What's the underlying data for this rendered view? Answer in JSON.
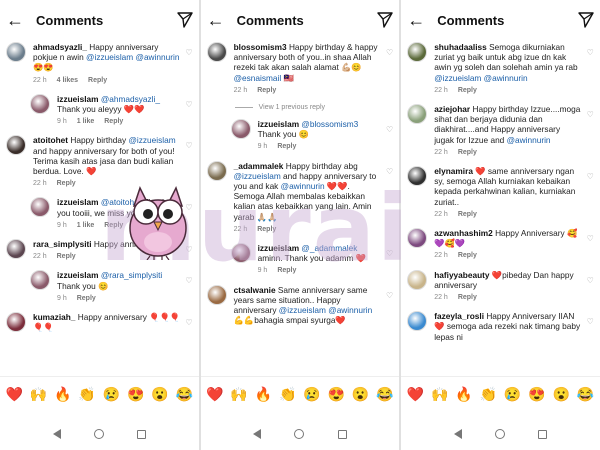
{
  "header": {
    "title": "Comments"
  },
  "emoji_bar": [
    "❤️",
    "🙌",
    "🔥",
    "👏",
    "😢",
    "😍",
    "😮",
    "😂"
  ],
  "watermark": "murai",
  "screens": [
    {
      "items": [
        {
          "kind": "comment",
          "user": "ahmadsyazli_",
          "parts": [
            {
              "t": "Happy anniversary pokjue n awin "
            },
            {
              "m": "@izzueislam"
            },
            {
              "t": " "
            },
            {
              "m": "@awinnurin"
            },
            {
              "t": " 😍😍"
            }
          ],
          "time": "22 h",
          "likes": "4 likes",
          "reply": "Reply",
          "avatar": "#6b7d8c"
        },
        {
          "kind": "reply",
          "user": "izzueislam",
          "parts": [
            {
              "m": "@ahmadsyazli_"
            },
            {
              "t": " Thank you aleyyy ❤️❤️"
            }
          ],
          "time": "9 h",
          "likes": "1 like",
          "reply": "Reply",
          "avatar": "#8a5a6a"
        },
        {
          "kind": "comment",
          "user": "atoitohet",
          "parts": [
            {
              "t": "Happy birthday "
            },
            {
              "m": "@izzueislam"
            },
            {
              "t": " and happy anniversary for both of you! Terima kasih atas jasa dan budi kalian berdua. Love. ❤️"
            }
          ],
          "time": "22 h",
          "likes": "",
          "reply": "Reply",
          "avatar": "#3a2e2a"
        },
        {
          "kind": "reply",
          "user": "izzueislam",
          "parts": [
            {
              "m": "@atoitohet"
            },
            {
              "t": " Thank you tooiii, we miss youu ❤️"
            }
          ],
          "time": "9 h",
          "likes": "1 like",
          "reply": "Reply",
          "avatar": "#8a5a6a"
        },
        {
          "kind": "comment",
          "user": "rara_simplysiti",
          "parts": [
            {
              "t": "Happy anniversary❤️"
            }
          ],
          "time": "22 h",
          "likes": "",
          "reply": "Reply",
          "avatar": "#5c4650"
        },
        {
          "kind": "reply",
          "user": "izzueislam",
          "parts": [
            {
              "m": "@rara_simplysiti"
            },
            {
              "t": " Thank you 😊"
            }
          ],
          "time": "9 h",
          "likes": "",
          "reply": "Reply",
          "avatar": "#8a5a6a"
        },
        {
          "kind": "comment",
          "user": "kumaziah_",
          "parts": [
            {
              "t": "Happy anniversary 🎈🎈🎈🎈🎈"
            }
          ],
          "time": "",
          "likes": "",
          "reply": "",
          "avatar": "#7b2d3b"
        }
      ]
    },
    {
      "items": [
        {
          "kind": "comment",
          "user": "blossomism3",
          "parts": [
            {
              "t": "Happy birthday & happy anniversary both of you..in shaa Allah rezeki tak akan salah alamat 💪🏼😊 "
            },
            {
              "m": "@esnaismail"
            },
            {
              "t": " 🇲🇾"
            }
          ],
          "time": "22 h",
          "likes": "",
          "reply": "Reply",
          "avatar": "#4a4a4a"
        },
        {
          "kind": "view",
          "label": "View 1 previous reply"
        },
        {
          "kind": "reply",
          "user": "izzueislam",
          "parts": [
            {
              "m": "@blossomism3"
            },
            {
              "t": " Thank you 😊"
            }
          ],
          "time": "9 h",
          "likes": "",
          "reply": "Reply",
          "avatar": "#8a5a6a"
        },
        {
          "kind": "comment",
          "user": "_adammalek",
          "parts": [
            {
              "t": "Happy birthday abg "
            },
            {
              "m": "@izzueislam"
            },
            {
              "t": " and happy anniversary to you and kak "
            },
            {
              "m": "@awinnurin"
            },
            {
              "t": " ❤️❤️. Semoga Allah membalas kebaikkan kalian atas kebaikkan yang lain. Amin yarab 🙏🏼🙏🏼"
            }
          ],
          "time": "22 h",
          "likes": "",
          "reply": "Reply",
          "avatar": "#7a6b4e"
        },
        {
          "kind": "reply",
          "user": "izzueislam",
          "parts": [
            {
              "m": "@_adammalek"
            },
            {
              "t": " aminn. Thank you adamm ❤️"
            }
          ],
          "time": "9 h",
          "likes": "",
          "reply": "Reply",
          "avatar": "#8a5a6a"
        },
        {
          "kind": "comment",
          "user": "ctsalwanie",
          "parts": [
            {
              "t": "Same anniversary same years same situation.. Happy anniversary "
            },
            {
              "m": "@izzueislam"
            },
            {
              "t": " "
            },
            {
              "m": "@awinnurin"
            },
            {
              "t": " 💪💪bahagia smpai syurga❤️"
            }
          ],
          "time": "",
          "likes": "",
          "reply": "",
          "avatar": "#9a6a42"
        }
      ]
    },
    {
      "items": [
        {
          "kind": "comment",
          "user": "shuhadaaliss",
          "parts": [
            {
              "t": "Semoga dikurniakan zuriat yg baik untuk abg izue dn kak awin yg soleh dan solehah amin ya rab "
            },
            {
              "m": "@izzueislam"
            },
            {
              "t": " "
            },
            {
              "m": "@awinnurin"
            }
          ],
          "time": "22 h",
          "likes": "",
          "reply": "Reply",
          "avatar": "#5b6a3a"
        },
        {
          "kind": "comment",
          "user": "aziejohar",
          "parts": [
            {
              "t": "Happy birthday Izzue....moga sihat dan berjaya didunia dan diakhirat....and Happy anniversary jugak for Izzue and "
            },
            {
              "m": "@awinnurin"
            }
          ],
          "time": "22 h",
          "likes": "",
          "reply": "Reply",
          "avatar": "#8aa07a"
        },
        {
          "kind": "comment",
          "user": "elynamira",
          "parts": [
            {
              "t": "❤️ same anniversary ngan sy, semoga Allah kurniakan kebaikan kepada perkahwinan kalian, kurniakan zuriat.."
            }
          ],
          "time": "22 h",
          "likes": "",
          "reply": "Reply",
          "avatar": "#2f2f2f"
        },
        {
          "kind": "comment",
          "user": "azwanhashim2",
          "parts": [
            {
              "t": "Happy Anniversary 🥰 💜🥰💜"
            }
          ],
          "time": "22 h",
          "likes": "",
          "reply": "Reply",
          "avatar": "#7d4a7f"
        },
        {
          "kind": "comment",
          "user": "hafiyyabeauty",
          "parts": [
            {
              "t": "❤️pibeday Dan happy anniversary"
            }
          ],
          "time": "22 h",
          "likes": "",
          "reply": "Reply",
          "avatar": "#c8b48a"
        },
        {
          "kind": "comment",
          "user": "fazeyla_rosli",
          "parts": [
            {
              "t": "Happy Anniversary IIAN ❤️ semoga ada rezeki nak timang baby lepas ni"
            }
          ],
          "time": "",
          "likes": "",
          "reply": "",
          "avatar": "#3a8ad0"
        }
      ]
    }
  ]
}
